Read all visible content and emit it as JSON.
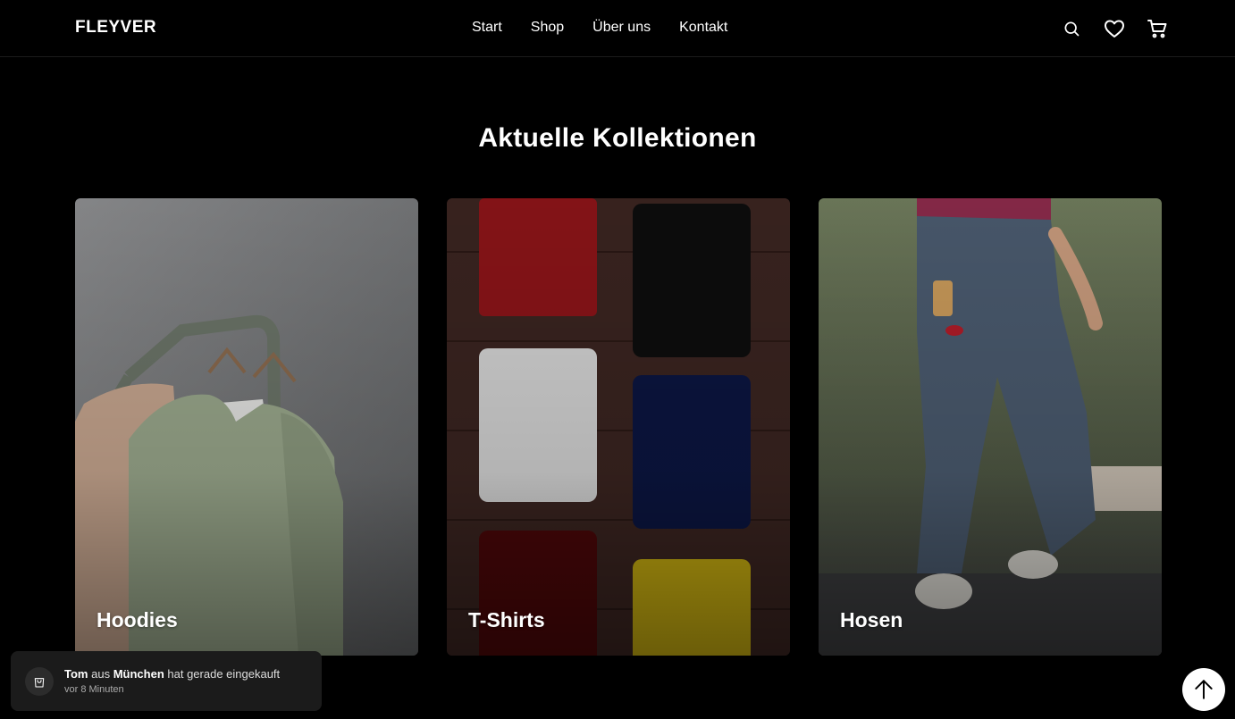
{
  "header": {
    "logo": "FLEYVER",
    "nav": [
      {
        "label": "Start"
      },
      {
        "label": "Shop"
      },
      {
        "label": "Über uns"
      },
      {
        "label": "Kontakt"
      }
    ],
    "icons": [
      "search-icon",
      "heart-icon",
      "cart-icon"
    ]
  },
  "section": {
    "title": "Aktuelle Kollektionen",
    "cards": [
      {
        "label": "Hoodies"
      },
      {
        "label": "T-Shirts"
      },
      {
        "label": "Hosen"
      }
    ]
  },
  "toast": {
    "name": "Tom",
    "from": "aus",
    "city": "München",
    "action": "hat gerade eingekauft",
    "time": "vor 8 Minuten"
  },
  "colors": {
    "background": "#000000",
    "toast_bg": "#1b1b1b",
    "accent": "#ffffff"
  }
}
